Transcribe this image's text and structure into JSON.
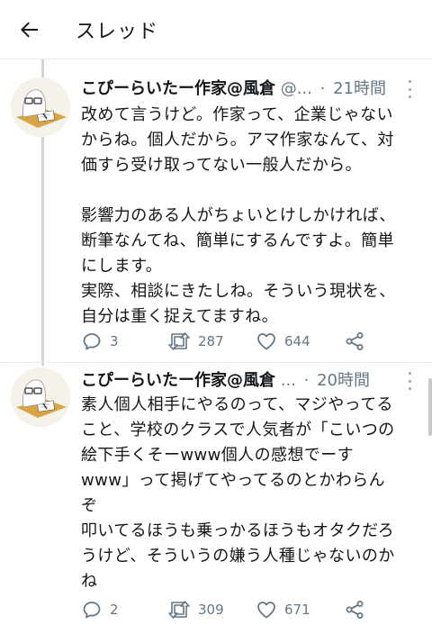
{
  "header": {
    "title": "スレッド"
  },
  "tweets": [
    {
      "name": "こぴーらいたー作家@風倉",
      "handle": "@...",
      "time": "21時間",
      "text": "改めて言うけど。作家って、企業じゃない\nからね。個人だから。アマ作家なんて、対\n価すら受け取ってない一般人だから。\n\n影響力のある人がちょいとけしかければ、\n断筆なんてね、簡単にするんですよ。簡単\nにします。\n実際、相談にきたしね。そういう現状を、\n自分は重く捉えてますね。",
      "replies": "3",
      "retweets": "287",
      "likes": "644"
    },
    {
      "name": "こぴーらいたー作家@風倉",
      "handle": "...",
      "time": "20時間",
      "text": "素人個人相手にやるのって、マジやってる\nこと、学校のクラスで人気者が「こいつの\n絵下手くそーwww個人の感想でーす\nwww」って掲げてやってるのとかわらん\nぞ\n叩いてるほうも乗っかるほうもオタクだろ\nうけど、そういうの嫌う人種じゃないのか\nね",
      "replies": "2",
      "retweets": "309",
      "likes": "671"
    }
  ],
  "colors": {
    "text": "#14171a",
    "muted": "#657786",
    "thread_line": "#ccd6dd",
    "divider": "#e6ecf0"
  }
}
